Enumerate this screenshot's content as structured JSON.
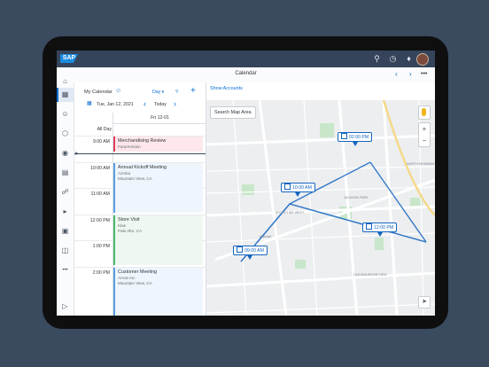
{
  "app": {
    "brand": "SAP",
    "title": "Calendar"
  },
  "shell": {
    "icons": [
      "search-icon",
      "history-icon",
      "bell-icon",
      "user-avatar"
    ]
  },
  "rail": {
    "items": [
      "home-icon",
      "calendar-icon",
      "contacts-icon",
      "product-icon",
      "location-icon",
      "table-icon",
      "hierarchy-icon",
      "megaphone-icon",
      "opportunity-icon",
      "documents-icon",
      "more-icon",
      "play-icon"
    ]
  },
  "calendar": {
    "title": "My Calendar",
    "view": "Day",
    "date": "Tue, Jan 12, 2021",
    "today": "Today",
    "day_header": "Fri 12-01",
    "all_day": "All Day",
    "hours": [
      "9:00 AM",
      "10:00 AM",
      "11:00 AM",
      "12:00 PM",
      "1:00 PM",
      "2:00 PM"
    ],
    "appointments": [
      {
        "title": "Merchandising Review",
        "sub1": "FutureVision",
        "sub2": "",
        "color": "#e0405a",
        "bg": "#fde7ea"
      },
      {
        "title": "Annual Kickoff Meeting",
        "sub1": "Azmka",
        "sub2": "Mountain View, CA",
        "color": "#5a9fe0",
        "bg": "#eef5fc"
      },
      {
        "title": "Store Visit",
        "sub1": "Klas",
        "sub2": "Palo Alto, CA",
        "color": "#4cb96b",
        "bg": "#eef8f1"
      },
      {
        "title": "Customer Meeting",
        "sub1": "Arrow Inc",
        "sub2": "Mountain View, CA",
        "color": "#5a9fe0",
        "bg": "#eef5fc"
      }
    ]
  },
  "map": {
    "show_accounts": "Show Accounts",
    "search_area": "Search Map Area",
    "pins": [
      "02:00 PM",
      "10:00 AM",
      "12:00 PM",
      "09:00 AM"
    ],
    "labels": [
      "JACKSON PARK",
      "SHORELINE WEST",
      "OLD MOUNTAIN VIEW",
      "NORTH WHISMAN",
      "Walmart"
    ]
  },
  "colors": {
    "accent": "#0a6ed1",
    "route": "#1565c0",
    "shell": "#35445a"
  }
}
